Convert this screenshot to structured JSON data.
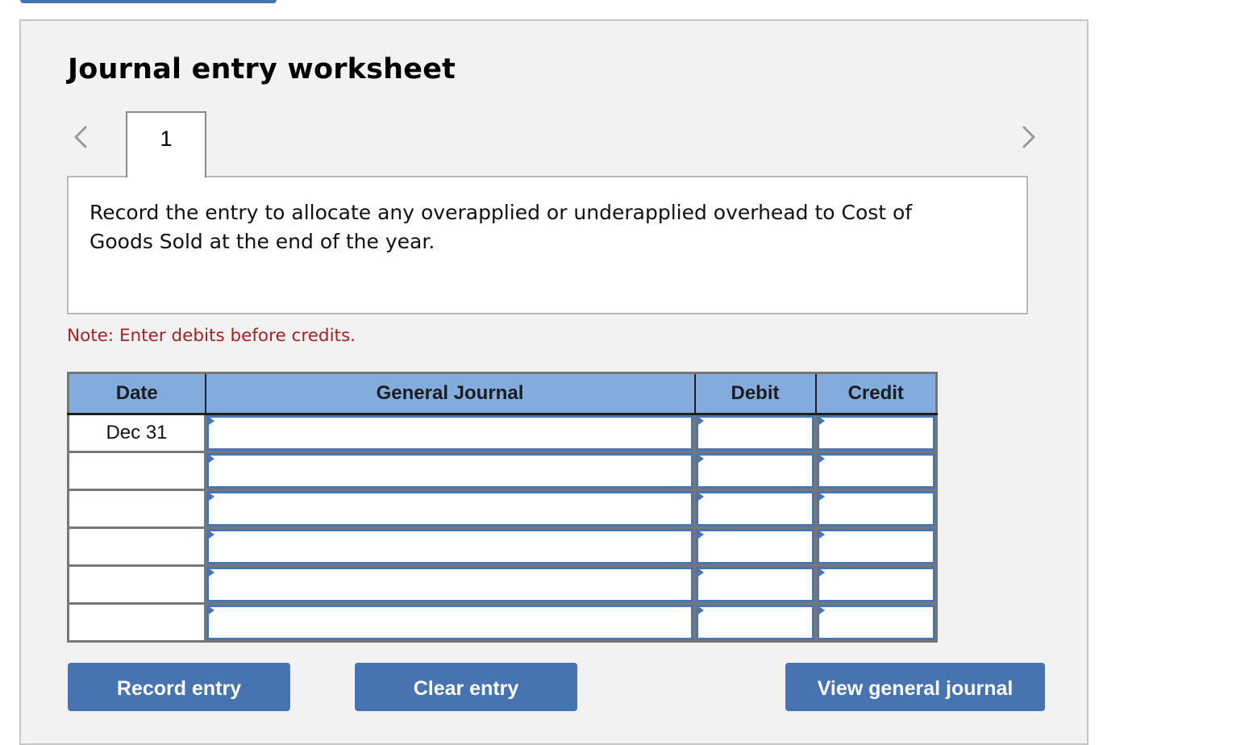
{
  "header": {
    "title": "Journal entry worksheet"
  },
  "navigation": {
    "prev_icon": "chevron-left-icon",
    "next_icon": "chevron-right-icon",
    "tabs": [
      {
        "label": "1",
        "active": true
      }
    ]
  },
  "instruction": {
    "text": "Record the entry to allocate any overapplied or underapplied overhead to Cost of Goods Sold at the end of the year."
  },
  "note": "Note: Enter debits before credits.",
  "colors": {
    "header_bg": "#82abde",
    "button_bg": "#4773b0",
    "input_border": "#4a75b3",
    "note_text": "#a82121",
    "panel_bg": "#f2f2f2"
  },
  "journal": {
    "columns": [
      "Date",
      "General Journal",
      "Debit",
      "Credit"
    ],
    "rows": [
      {
        "date": "Dec 31",
        "account": "",
        "debit": "",
        "credit": ""
      },
      {
        "date": "",
        "account": "",
        "debit": "",
        "credit": ""
      },
      {
        "date": "",
        "account": "",
        "debit": "",
        "credit": ""
      },
      {
        "date": "",
        "account": "",
        "debit": "",
        "credit": ""
      },
      {
        "date": "",
        "account": "",
        "debit": "",
        "credit": ""
      },
      {
        "date": "",
        "account": "",
        "debit": "",
        "credit": ""
      }
    ]
  },
  "buttons": {
    "record": "Record entry",
    "clear": "Clear entry",
    "view": "View general journal"
  }
}
